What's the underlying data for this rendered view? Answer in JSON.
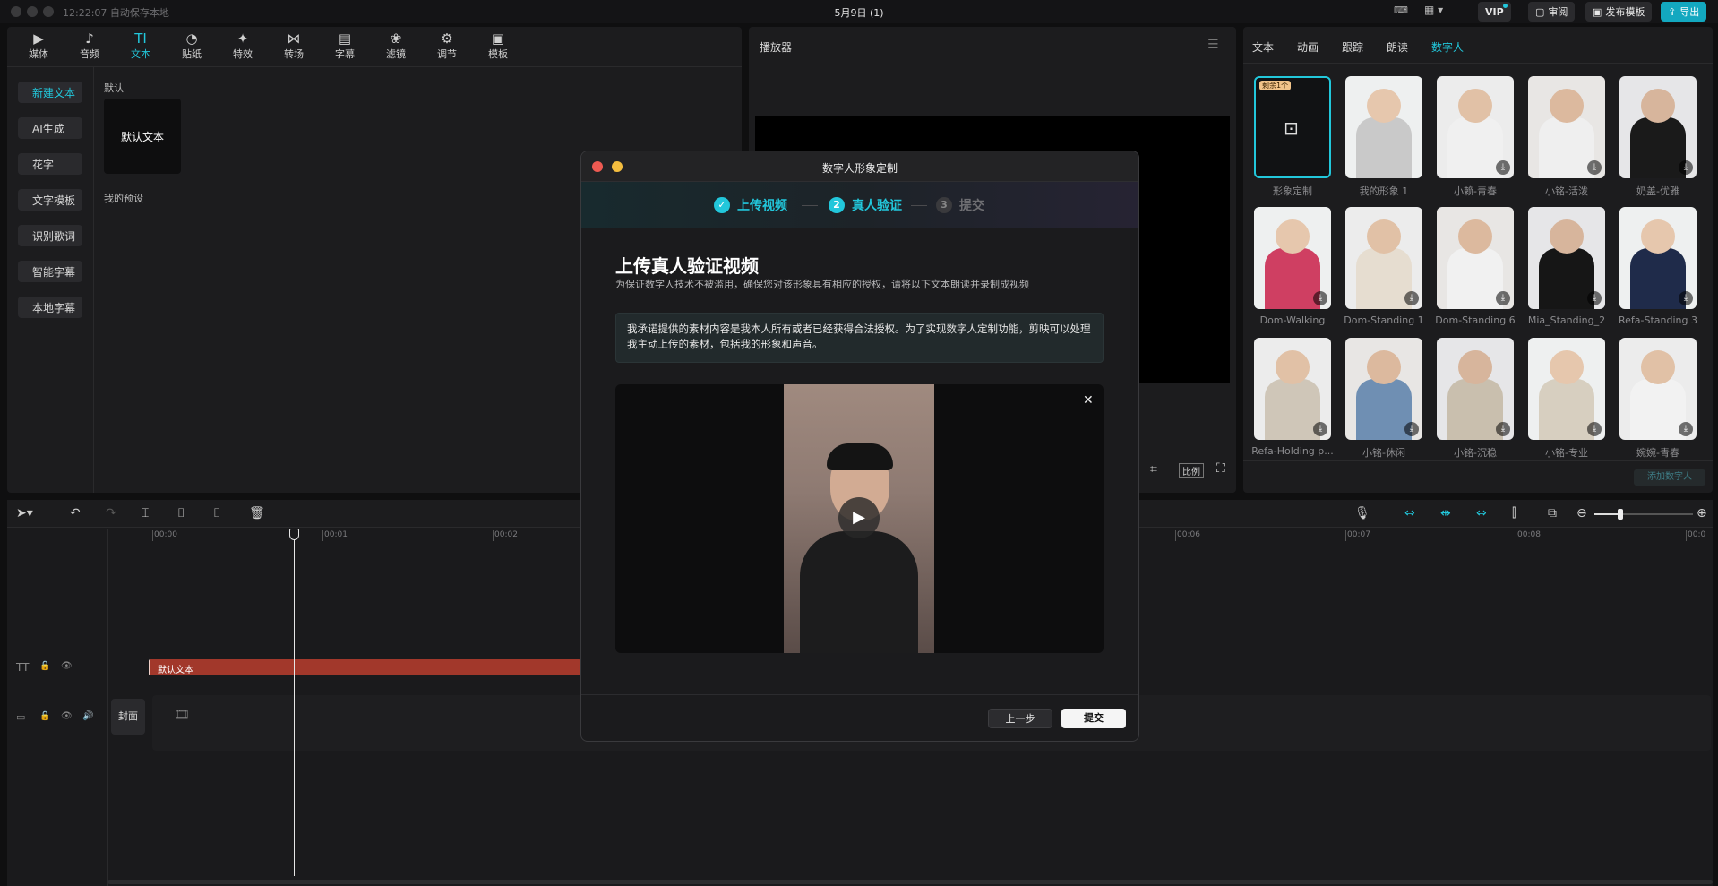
{
  "topbar": {
    "time_status": "12:22:07 自动保存本地",
    "title": "5月9日 (1)",
    "vip": "VIP",
    "review": "审阅",
    "publish": "发布模板",
    "export": "导出"
  },
  "tools": [
    {
      "label": "媒体",
      "icon": "media-icon"
    },
    {
      "label": "音频",
      "icon": "audio-icon"
    },
    {
      "label": "文本",
      "icon": "text-icon",
      "active": true
    },
    {
      "label": "贴纸",
      "icon": "sticker-icon"
    },
    {
      "label": "特效",
      "icon": "effects-icon"
    },
    {
      "label": "转场",
      "icon": "transition-icon"
    },
    {
      "label": "字幕",
      "icon": "subtitle-icon"
    },
    {
      "label": "滤镜",
      "icon": "filter-icon"
    },
    {
      "label": "调节",
      "icon": "adjust-icon"
    },
    {
      "label": "模板",
      "icon": "template-icon"
    }
  ],
  "left_nav": [
    "新建文本",
    "AI生成",
    "花字",
    "文字模板",
    "识别歌词",
    "智能字幕",
    "本地字幕"
  ],
  "text_panel": {
    "section_default": "默认",
    "default_text": "默认文本",
    "section_presets": "我的预设"
  },
  "player": {
    "title": "播放器",
    "ratio": "比例"
  },
  "right_tabs": [
    "文本",
    "动画",
    "跟踪",
    "朗读",
    "数字人"
  ],
  "custom_badge": "剩余1个",
  "avatars": [
    "形象定制",
    "我的形象 1",
    "小赖-青春",
    "小铭-活泼",
    "奶盖-优雅",
    "Dom-Walking",
    "Dom-Standing 1",
    "Dom-Standing 6",
    "Mia_Standing_2",
    "Refa-Standing 3",
    "Refa-Holding p...",
    "小铭-休闲",
    "小铭-沉稳",
    "小铭-专业",
    "婉婉-青春"
  ],
  "add_digital_human": "添加数字人",
  "ruler": [
    "00:00",
    "00:01",
    "00:02",
    "00:06",
    "00:07",
    "00:08",
    "00:0"
  ],
  "track": {
    "text_clip": "默认文本",
    "cover": "封面"
  },
  "modal": {
    "title": "数字人形象定制",
    "steps": [
      {
        "num": "✓",
        "label": "上传视频"
      },
      {
        "num": "2",
        "label": "真人验证"
      },
      {
        "num": "3",
        "label": "提交"
      }
    ],
    "heading": "上传真人验证视频",
    "subtitle": "为保证数字人技术不被滥用，确保您对该形象具有相应的授权，请将以下文本朗读并录制成视频",
    "pledge": "我承诺提供的素材内容是我本人所有或者已经获得合法授权。为了实现数字人定制功能，剪映可以处理我主动上传的素材，包括我的形象和声音。",
    "prev": "上一步",
    "submit": "提交"
  },
  "colors": {
    "accent": "#22c7db",
    "clip": "#a2382b"
  }
}
